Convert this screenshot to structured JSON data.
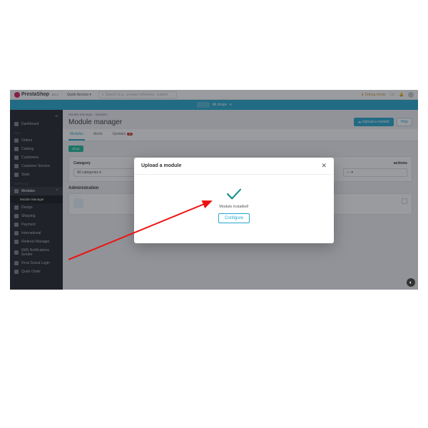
{
  "brand": "PrestaShop",
  "version": "8.0.1",
  "quick_access": "Quick Access",
  "search_placeholder": "Search (e.g.: product reference, custom",
  "debug_mode": "Debug mode",
  "shopbar_label": "All shops",
  "sidebar": {
    "dashboard": "Dashboard",
    "sell_head": "SELL",
    "sell": [
      "Orders",
      "Catalog",
      "Customers",
      "Customer Service",
      "Stats"
    ],
    "improve_head": "IMPROVE",
    "modules": "Modules",
    "module_manager": "Module Manager",
    "improve_rest": [
      "Design",
      "Shipping",
      "Payment",
      "International",
      "Redirect Manager",
      "SMS Notifications Sender",
      "Firva Social Login",
      "Quick Order"
    ]
  },
  "breadcrumb": "Module Manager › Modules",
  "page_title": "Module manager",
  "upload_btn": "Upload a module",
  "help_btn": "Help",
  "tabs": {
    "modules": "Modules",
    "alerts": "Alerts",
    "updates": "Updates",
    "updates_badge": "12"
  },
  "pill": "Shop",
  "category_label": "Category",
  "category_value": "All categories",
  "actions_label": "actions",
  "admin_label": "Administration",
  "modal": {
    "title": "Upload a module",
    "message": "Module installed!",
    "configure": "Configure"
  }
}
